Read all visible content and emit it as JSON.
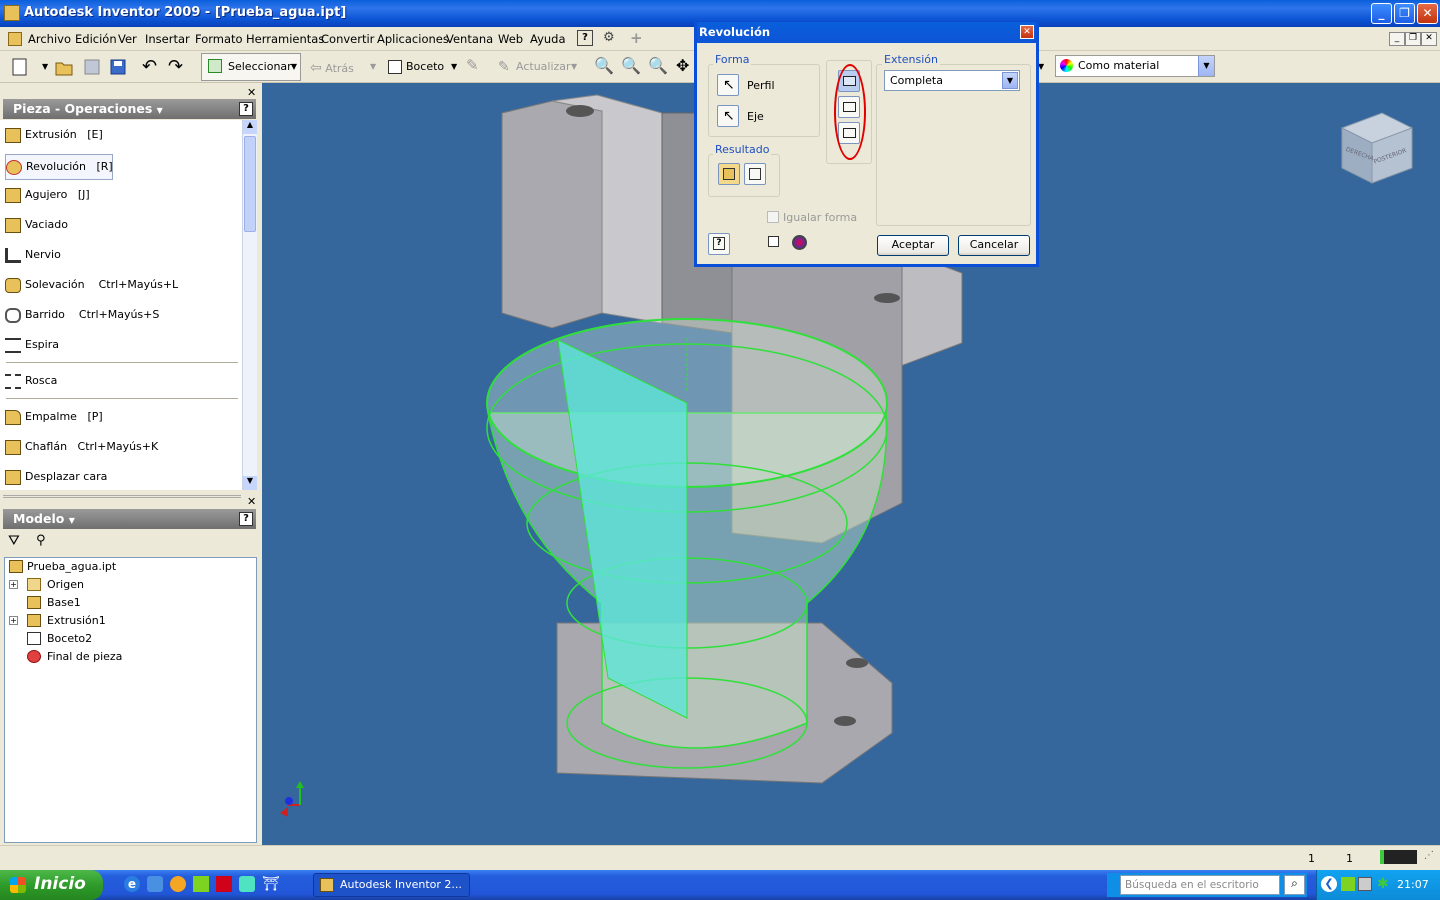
{
  "window": {
    "title": "Autodesk Inventor 2009 - [Prueba_agua.ipt]"
  },
  "menu": [
    "Archivo",
    "Edición",
    "Ver",
    "Insertar",
    "Formato",
    "Herramientas",
    "Convertir",
    "Aplicaciones",
    "Ventana",
    "Web",
    "Ayuda"
  ],
  "toolbar": {
    "select_label": "Seleccionar",
    "back_label": "Atrás",
    "sketch_label": "Boceto",
    "update_label": "Actualizar",
    "material_label": "Como material"
  },
  "operations_panel": {
    "title": "Pieza - Operaciones",
    "items": [
      {
        "label": "Extrusión",
        "shortcut": "[E]"
      },
      {
        "label": "Revolución",
        "shortcut": "[R]"
      },
      {
        "label": "Agujero",
        "shortcut": "[J]"
      },
      {
        "label": "Vaciado",
        "shortcut": ""
      },
      {
        "label": "Nervio",
        "shortcut": ""
      },
      {
        "label": "Solevación",
        "shortcut": "Ctrl+Mayús+L"
      },
      {
        "label": "Barrido",
        "shortcut": "Ctrl+Mayús+S"
      },
      {
        "label": "Espira",
        "shortcut": ""
      },
      {
        "label": "Rosca",
        "shortcut": ""
      },
      {
        "label": "Empalme",
        "shortcut": "[P]"
      },
      {
        "label": "Chaflán",
        "shortcut": "Ctrl+Mayús+K"
      },
      {
        "label": "Desplazar cara",
        "shortcut": ""
      }
    ]
  },
  "model_panel": {
    "title": "Modelo",
    "tree": [
      "Prueba_agua.ipt",
      "Origen",
      "Base1",
      "Extrusión1",
      "Boceto2",
      "Final de pieza"
    ]
  },
  "dialog": {
    "title": "Revolución",
    "forma_label": "Forma",
    "perfil_label": "Perfil",
    "eje_label": "Eje",
    "resultado_label": "Resultado",
    "extension_label": "Extensión",
    "extension_value": "Completa",
    "igualar_label": "Igualar forma",
    "accept_label": "Aceptar",
    "cancel_label": "Cancelar"
  },
  "viewcube": {
    "face1": "DERECHA",
    "face2": "POSTERIOR"
  },
  "status": {
    "value1": "1",
    "value2": "1"
  },
  "taskbar": {
    "start_label": "Inicio",
    "task_label": "Autodesk Inventor 2...",
    "search_placeholder": "Búsqueda en el escritorio",
    "clock": "21:07"
  },
  "colors": {
    "viewport": "#35679D",
    "titlebar": "#0A5FDB",
    "highlight_circle": "#E00000",
    "sketch_green": "#2FE03A",
    "plane_cyan": "#5EE6D8"
  }
}
